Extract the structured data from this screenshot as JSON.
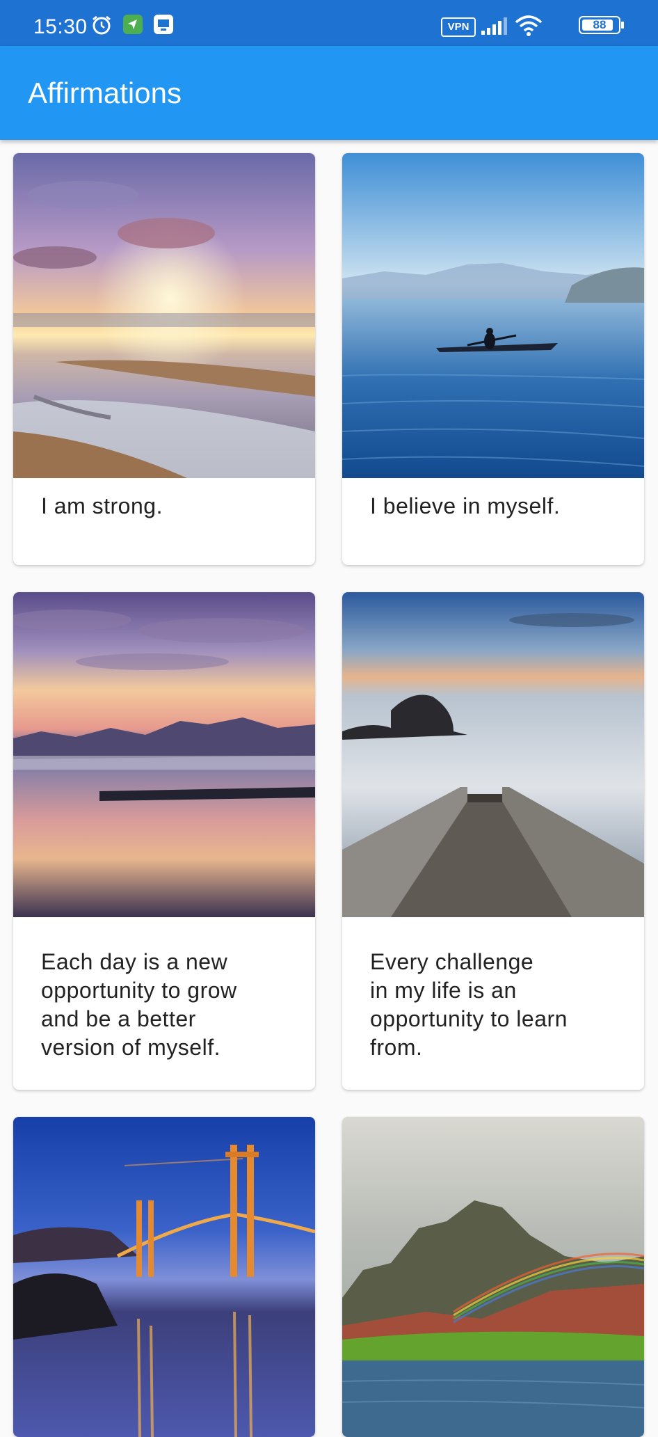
{
  "status_bar": {
    "time": "15:30",
    "vpn": "VPN",
    "battery": "88",
    "icons": [
      "alarm-icon",
      "location-app-icon",
      "screen-app-icon",
      "vpn-icon",
      "signal-icon",
      "wifi-icon",
      "battery-icon"
    ]
  },
  "app_bar": {
    "title": "Affirmations"
  },
  "cards": [
    {
      "text": "I am strong.",
      "image": "beach-sunset"
    },
    {
      "text": "I believe in myself.",
      "image": "kayak-lake"
    },
    {
      "text": "Each day is a new\nopportunity to grow\nand be a better\nversion of myself.",
      "image": "lake-sunset-mountains"
    },
    {
      "text": "Every challenge\nin my life is an\nopportunity to learn\nfrom.",
      "image": "pier-ocean-rocks"
    },
    {
      "text": "",
      "image": "golden-gate-bridge-night"
    },
    {
      "text": "",
      "image": "mountain-rainbow"
    }
  ],
  "colors": {
    "status_bar": "#1e73d2",
    "app_bar": "#2196f3",
    "background": "#fafafa"
  }
}
